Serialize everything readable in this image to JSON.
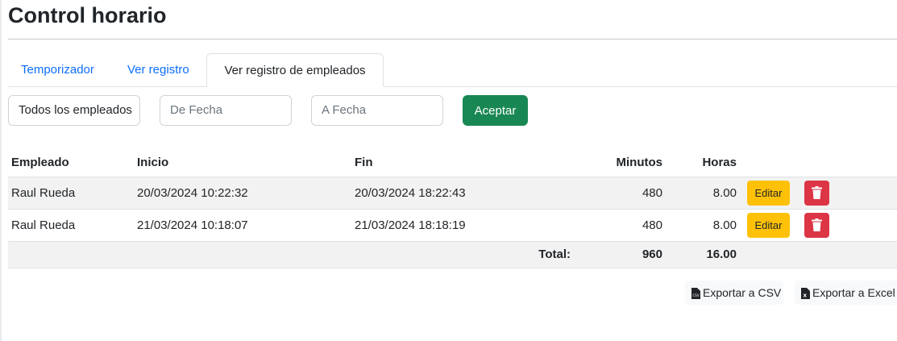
{
  "page": {
    "title": "Control horario"
  },
  "tabs": [
    {
      "label": "Temporizador",
      "active": false
    },
    {
      "label": "Ver registro",
      "active": false
    },
    {
      "label": "Ver registro de empleados",
      "active": true
    }
  ],
  "filters": {
    "employee_select": "Todos los empleados",
    "from_date_placeholder": "De Fecha",
    "to_date_placeholder": "A Fecha",
    "accept_label": "Aceptar"
  },
  "table": {
    "headers": [
      "Empleado",
      "Inicio",
      "Fin",
      "Minutos",
      "Horas"
    ],
    "rows": [
      {
        "empleado": "Raul Rueda",
        "inicio": "20/03/2024 10:22:32",
        "fin": "20/03/2024 18:22:43",
        "minutos": "480",
        "horas": "8.00"
      },
      {
        "empleado": "Raul Rueda",
        "inicio": "21/03/2024 10:18:07",
        "fin": "21/03/2024 18:18:19",
        "minutos": "480",
        "horas": "8.00"
      }
    ],
    "edit_label": "Editar",
    "total": {
      "label": "Total:",
      "minutos": "960",
      "horas": "16.00"
    }
  },
  "exports": {
    "csv_label": "Exportar a CSV",
    "excel_label": "Exportar a Excel"
  },
  "colors": {
    "accept": "#198754",
    "edit": "#ffc107",
    "delete": "#dc3545",
    "link": "#0d6efd"
  }
}
